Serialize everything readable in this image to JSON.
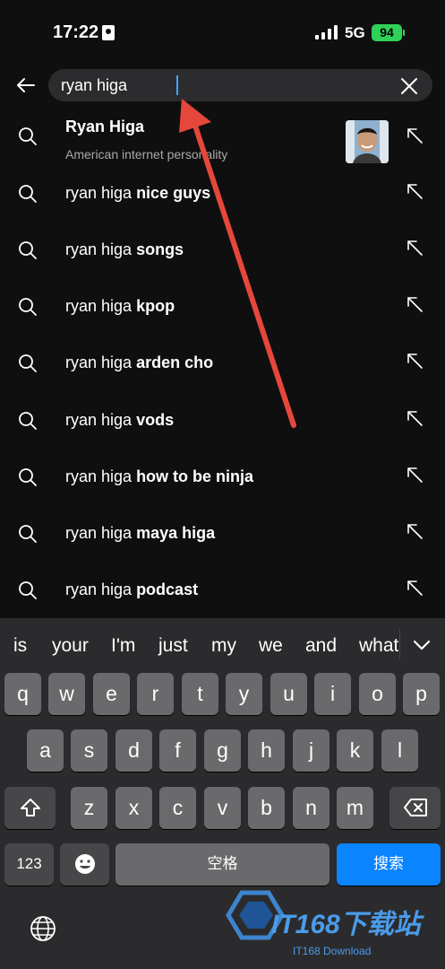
{
  "status_bar": {
    "time": "17:22",
    "network": "5G",
    "battery": "94"
  },
  "search": {
    "query": "ryan higa"
  },
  "suggestions": [
    {
      "prefix": "Ryan Higa",
      "bold": "",
      "subtitle": "American internet personality",
      "has_thumbnail": true
    },
    {
      "prefix": "ryan higa ",
      "bold": "nice guys"
    },
    {
      "prefix": "ryan higa ",
      "bold": "songs"
    },
    {
      "prefix": "ryan higa ",
      "bold": "kpop"
    },
    {
      "prefix": "ryan higa ",
      "bold": "arden cho"
    },
    {
      "prefix": "ryan higa ",
      "bold": "vods"
    },
    {
      "prefix": "ryan higa ",
      "bold": "how to be ninja"
    },
    {
      "prefix": "ryan higa ",
      "bold": "maya higa"
    },
    {
      "prefix": "ryan higa ",
      "bold": "podcast"
    }
  ],
  "keyboard": {
    "predictions": [
      "is",
      "your",
      "I'm",
      "just",
      "my",
      "we",
      "and",
      "what"
    ],
    "row1": [
      "q",
      "w",
      "e",
      "r",
      "t",
      "y",
      "u",
      "i",
      "o",
      "p"
    ],
    "row2": [
      "a",
      "s",
      "d",
      "f",
      "g",
      "h",
      "j",
      "k",
      "l"
    ],
    "row3": [
      "z",
      "x",
      "c",
      "v",
      "b",
      "n",
      "m"
    ],
    "numbers_label": "123",
    "space_label": "空格",
    "search_label": "搜索"
  },
  "watermark": {
    "brand": "IT168下载站",
    "sub": "IT168 Download"
  },
  "colors": {
    "accent": "#0a84ff",
    "battery": "#30d158",
    "arrow": "#e5473b"
  }
}
